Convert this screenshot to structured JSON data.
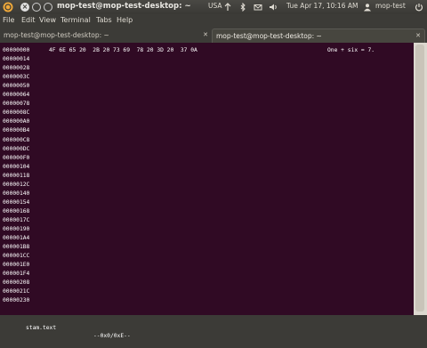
{
  "panel": {
    "window_title": "mop-test@mop-test-desktop: ~",
    "keyboard_layout": "USA",
    "datetime": "Tue Apr 17, 10:16 AM",
    "user": "mop-test"
  },
  "menu": [
    "File",
    "Edit",
    "View",
    "Terminal",
    "Tabs",
    "Help"
  ],
  "tabs": [
    {
      "label": "mop-test@mop-test-desktop: ~",
      "active": false
    },
    {
      "label": "mop-test@mop-test-desktop: ~",
      "active": true
    }
  ],
  "hexdump": {
    "first_bytes": "4F 6E 65 20  2B 20 73 69  78 20 3D 20  37 0A",
    "ascii": "One + six = 7.",
    "offsets": [
      "00000000",
      "00000014",
      "00000028",
      "0000003C",
      "00000050",
      "00000064",
      "00000078",
      "0000008C",
      "000000A0",
      "000000B4",
      "000000C8",
      "000000DC",
      "000000F0",
      "00000104",
      "00000118",
      "0000012C",
      "00000140",
      "00000154",
      "00000168",
      "0000017C",
      "00000190",
      "000001A4",
      "000001B8",
      "000001CC",
      "000001E0",
      "000001F4",
      "00000208",
      "0000021C",
      "00000230"
    ]
  },
  "status": {
    "dashes": "---",
    "filename": "stam.text",
    "position": "--0x0/0xE--"
  },
  "colors": {
    "terminal_bg": "#300a24",
    "terminal_fg": "#ffffff",
    "panel_bg": "#3c3b37"
  }
}
